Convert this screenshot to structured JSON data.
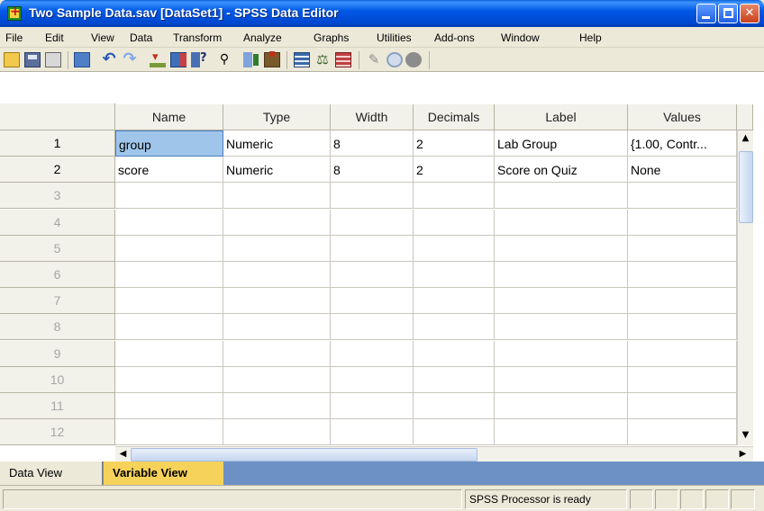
{
  "window": {
    "title": "Two Sample Data.sav [DataSet1] - SPSS Data Editor",
    "buttons": {
      "minimize": "minimize",
      "maximize": "maximize",
      "close": "✕"
    }
  },
  "menu": {
    "items": [
      "File",
      "Edit",
      "View",
      "Data",
      "Transform",
      "Analyze",
      "Graphs",
      "Utilities",
      "Add-ons",
      "Window",
      "Help"
    ]
  },
  "toolbar": {
    "icons": [
      "open-icon",
      "save-icon",
      "print-icon",
      "recall-dialog-icon",
      "undo-icon",
      "redo-icon",
      "goto-case-icon",
      "variables-icon",
      "help-icon",
      "find-icon",
      "insert-cases-icon",
      "insert-variable-icon",
      "split-file-icon",
      "weight-cases-icon",
      "select-cases-icon",
      "value-labels-icon",
      "use-sets-icon",
      "show-all-variables-icon"
    ]
  },
  "grid": {
    "columns": [
      "Name",
      "Type",
      "Width",
      "Decimals",
      "Label",
      "Values"
    ],
    "row_numbers": [
      "1",
      "2",
      "3",
      "4",
      "5",
      "6",
      "7",
      "8",
      "9",
      "10",
      "11",
      "12"
    ],
    "rows": [
      {
        "name": "group",
        "type": "Numeric",
        "width": "8",
        "decimals": "2",
        "label": "Lab Group",
        "values": "{1.00, Contr..."
      },
      {
        "name": "score",
        "type": "Numeric",
        "width": "8",
        "decimals": "2",
        "label": "Score on Quiz",
        "values": "None"
      }
    ],
    "selected_cell": "group"
  },
  "tabs": {
    "data_view": "Data View",
    "variable_view": "Variable View",
    "active": "Variable View"
  },
  "status": {
    "processor": "SPSS  Processor is ready"
  },
  "colors": {
    "title_bar": "#0058e6",
    "active_tab": "#f6d25a",
    "tab_strip": "#6d91c4",
    "selection": "#9fc6ea"
  }
}
